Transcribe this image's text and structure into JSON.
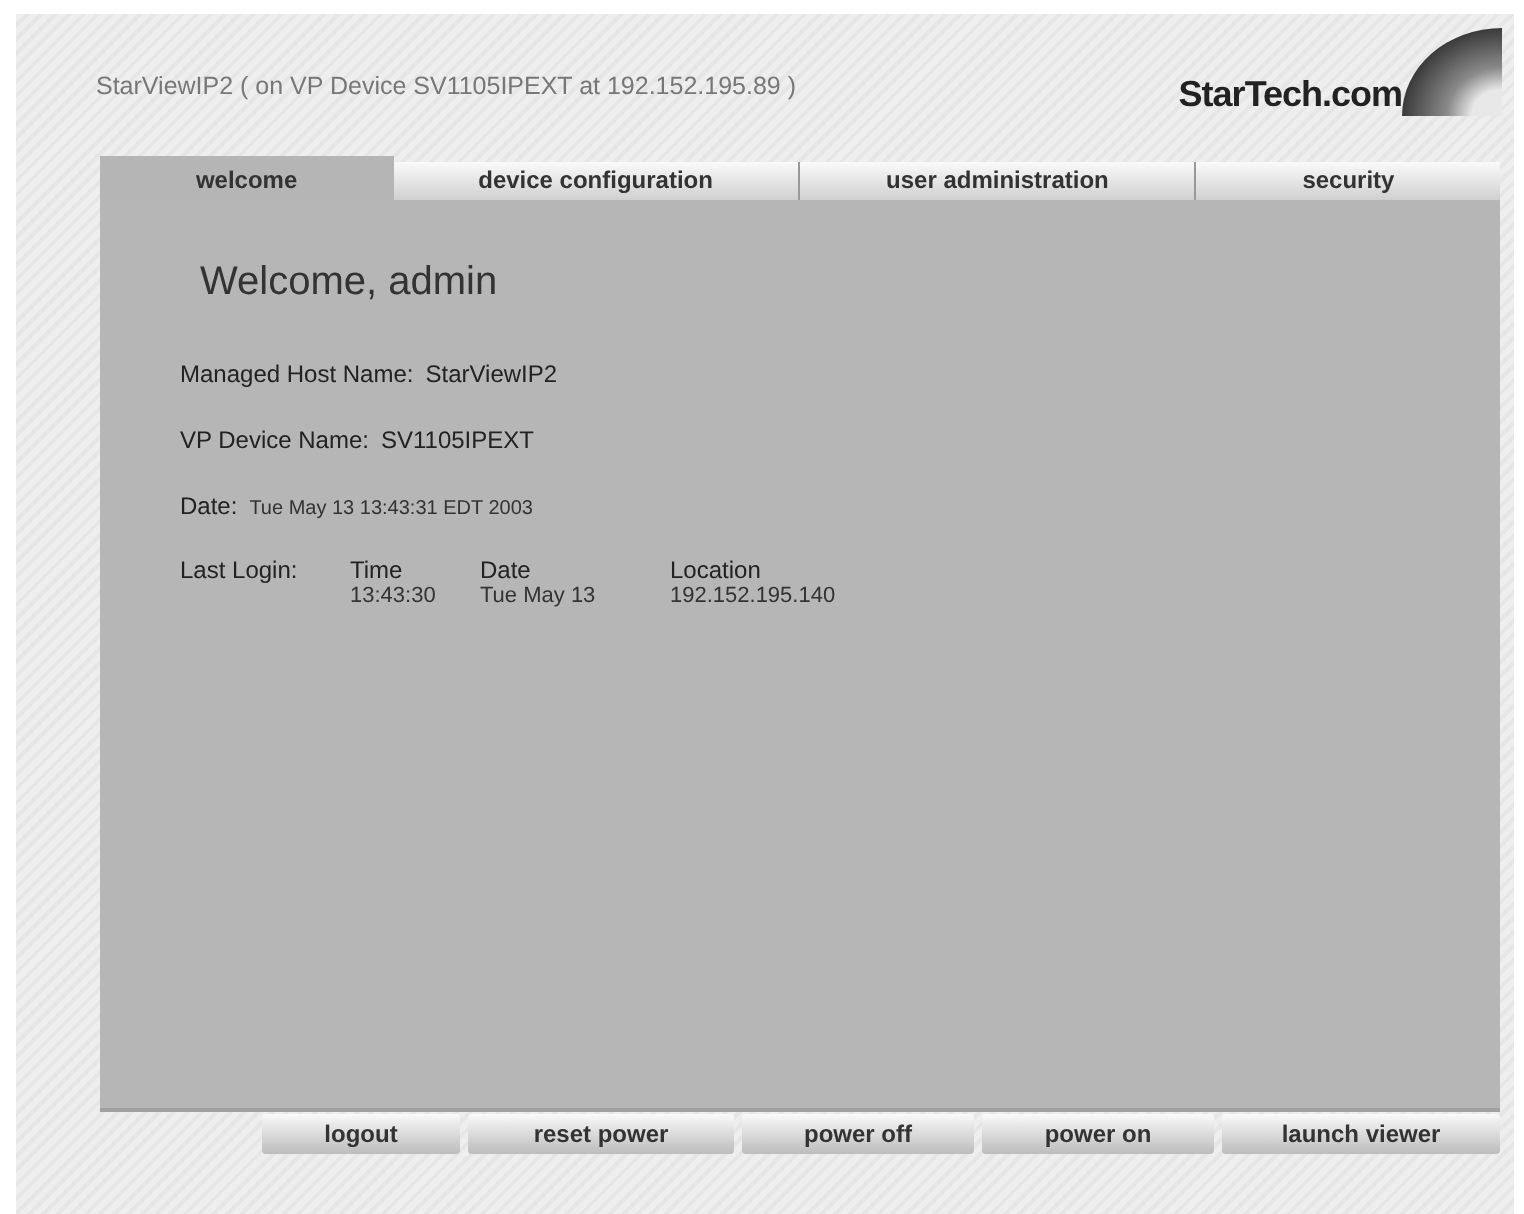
{
  "header": {
    "title": "StarViewIP2 ( on VP Device SV1105IPEXT at 192.152.195.89 )",
    "logo": "StarTech.com"
  },
  "tabs": [
    {
      "label": "welcome",
      "selected": true
    },
    {
      "label": "device configuration",
      "selected": false
    },
    {
      "label": "user administration",
      "selected": false
    },
    {
      "label": "security",
      "selected": false
    }
  ],
  "panel": {
    "heading": "Welcome, admin",
    "fields": [
      {
        "label": "Managed Host Name:",
        "value": "StarViewIP2",
        "kind": "large"
      },
      {
        "label": "VP Device Name:",
        "value": "SV1105IPEXT",
        "kind": "large"
      },
      {
        "label": "Date:",
        "value": "Tue May 13 13:43:31 EDT 2003",
        "kind": "small"
      }
    ],
    "last_login": {
      "label": "Last Login:",
      "columns": [
        "Time",
        "Date",
        "Location"
      ],
      "values": [
        "13:43:30",
        "Tue May 13",
        "192.152.195.140"
      ]
    }
  },
  "buttons": [
    "logout",
    "reset power",
    "power off",
    "power on",
    "launch viewer"
  ]
}
